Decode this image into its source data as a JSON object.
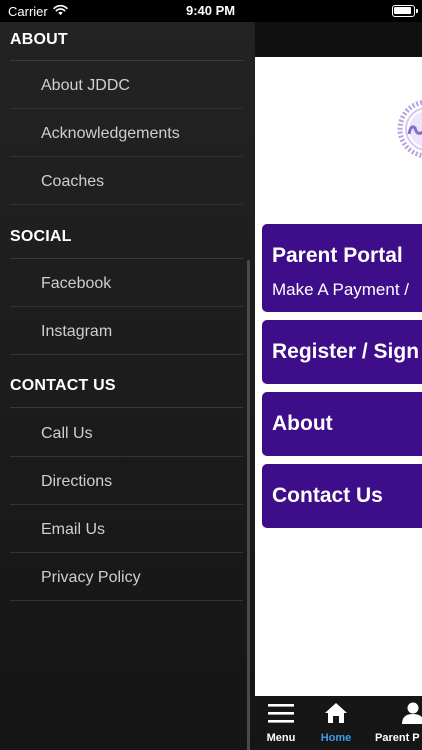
{
  "status": {
    "carrier": "Carrier",
    "time": "9:40 PM"
  },
  "drawer": {
    "sections": [
      {
        "title": "ABOUT",
        "items": [
          "About JDDC",
          "Acknowledgements",
          "Coaches"
        ]
      },
      {
        "title": "SOCIAL",
        "items": [
          "Facebook",
          "Instagram"
        ]
      },
      {
        "title": "CONTACT US",
        "items": [
          "Call Us",
          "Directions",
          "Email Us",
          "Privacy Policy"
        ]
      }
    ]
  },
  "main": {
    "tiles": [
      {
        "title": "Parent Portal",
        "subtitle": "Make A Payment /"
      },
      {
        "title": "Register / Sign"
      },
      {
        "title": "About"
      },
      {
        "title": "Contact Us"
      }
    ]
  },
  "tabbar": {
    "menu": "Menu",
    "home": "Home",
    "parent": "Parent P"
  },
  "colors": {
    "tile": "#3d0d8a",
    "active_tab": "#3a9ee8",
    "drawer_bg": "#1e1e1e"
  }
}
